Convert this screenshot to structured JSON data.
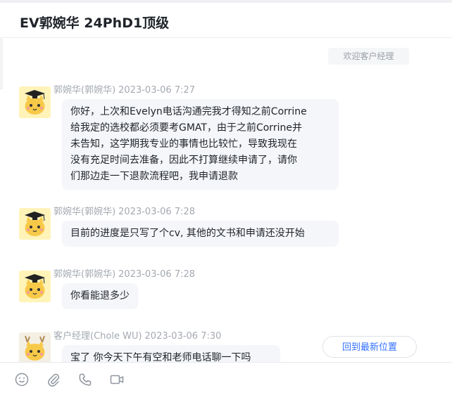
{
  "header": {
    "title": "EV郭婉华 24PhD1顶级"
  },
  "system_message": "欢迎客户经理",
  "messages": [
    {
      "sender": "郭婉华(郭婉华)",
      "time": "2023-03-06 7:27",
      "avatar": "cat-graduate-avatar",
      "lines": [
        "你好，上次和Evelyn电话沟通完我才得知之前Corrine",
        "给我定的选校都必须要考GMAT，由于之前Corrine并",
        "未告知，这学期我专业的事情也比较忙，导致我现在",
        "没有充足时间去准备，因此不打算继续申请了，请你",
        "们那边走一下退款流程吧，我申请退款"
      ]
    },
    {
      "sender": "郭婉华(郭婉华)",
      "time": "2023-03-06 7:28",
      "avatar": "cat-graduate-avatar",
      "lines": [
        "目前的进度是只写了个cv, 其他的文书和申请还没开始"
      ]
    },
    {
      "sender": "郭婉华(郭婉华)",
      "time": "2023-03-06 7:28",
      "avatar": "cat-graduate-avatar",
      "lines": [
        "你看能退多少"
      ]
    },
    {
      "sender": "客户经理(Chole WU)",
      "time": "2023-03-06 7:30",
      "avatar": "cat-antler-avatar",
      "lines": [
        "宝了 你今天下午有空和老师电话聊一下吗"
      ]
    }
  ],
  "jump_button": "回到最新位置",
  "toolbar": {
    "icons": [
      "emoji-icon",
      "paperclip-icon",
      "phone-icon",
      "video-icon"
    ]
  }
}
